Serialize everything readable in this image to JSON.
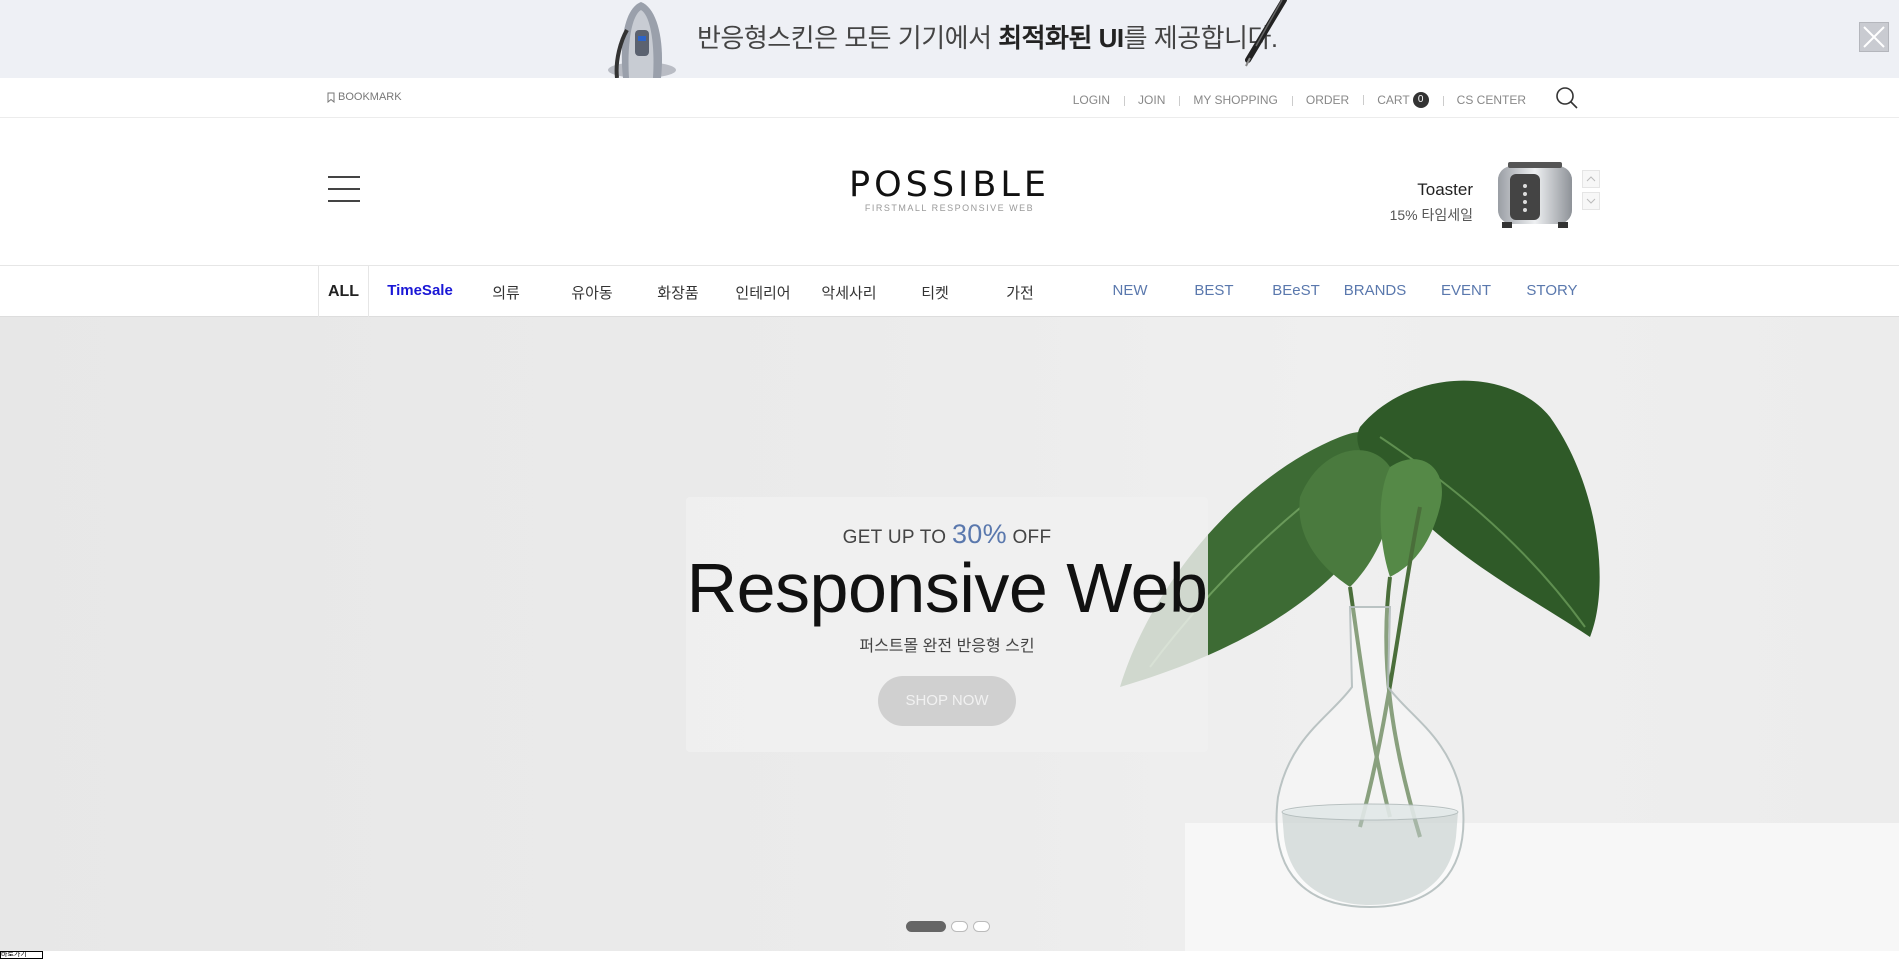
{
  "promo_banner": {
    "text_prefix": "반응형스킨은 모든 기기에서 ",
    "text_bold": "최적화된 UI",
    "text_suffix": "를 제공합니다."
  },
  "utility_bar": {
    "bookmark": "BOOKMARK",
    "links": [
      {
        "label": "LOGIN"
      },
      {
        "label": "JOIN"
      },
      {
        "label": "MY SHOPPING"
      },
      {
        "label": "ORDER"
      },
      {
        "label": "CART",
        "count": "0"
      },
      {
        "label": "CS CENTER"
      }
    ]
  },
  "header": {
    "logo": "POSSIBLE",
    "logo_sub": "FIRSTMALL RESPONSIVE WEB",
    "featured": {
      "name": "Toaster",
      "sale": "15% 타임세일"
    }
  },
  "nav": {
    "all": "ALL",
    "items": [
      {
        "label": "TimeSale"
      },
      {
        "label": "의류"
      },
      {
        "label": "유아동"
      },
      {
        "label": "화장품"
      },
      {
        "label": "인테리어"
      },
      {
        "label": "악세사리"
      },
      {
        "label": "티켓"
      },
      {
        "label": "가전"
      },
      {
        "label": "NEW"
      },
      {
        "label": "BEST"
      },
      {
        "label": "BEeST"
      },
      {
        "label": "BRANDS"
      },
      {
        "label": "EVENT"
      },
      {
        "label": "STORY"
      }
    ]
  },
  "hero": {
    "eyebrow_prefix": "GET UP TO ",
    "eyebrow_pct": "30%",
    "eyebrow_suffix": " OFF",
    "headline": "Responsive Web",
    "description": "퍼스트몰 완전 반응형 스킨",
    "cta": "SHOP NOW",
    "slides_total": 3,
    "slide_active": 1
  },
  "corner_label": "바로가기",
  "colors": {
    "accent_blue": "#5a78ad",
    "timesale": "#1a17d6",
    "banner_bg": "#eef0f5"
  }
}
